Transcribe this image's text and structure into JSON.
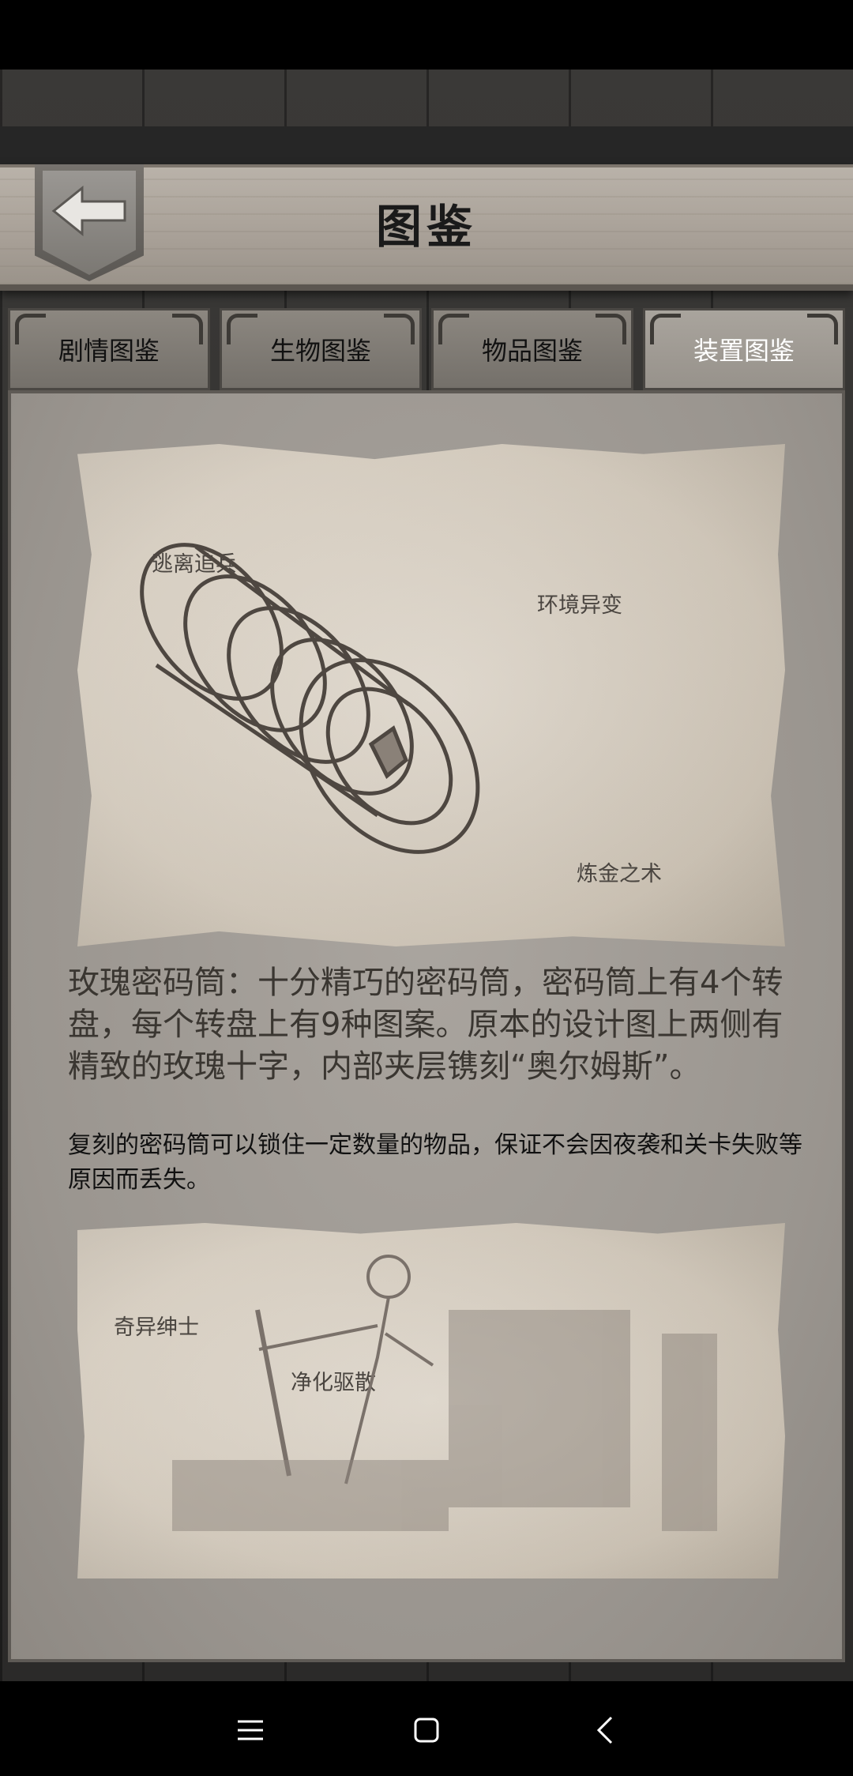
{
  "header": {
    "title": "图鉴"
  },
  "tabs": [
    {
      "label": "剧情图鉴"
    },
    {
      "label": "生物图鉴"
    },
    {
      "label": "物品图鉴"
    },
    {
      "label": "装置图鉴"
    }
  ],
  "entry1": {
    "labels": [
      "逃离追兵",
      "环境异变",
      "炼金之术"
    ],
    "description": "玫瑰密码筒：十分精巧的密码筒，密码筒上有4个转盘，每个转盘上有9种图案。原本的设计图上两侧有精致的玫瑰十字，内部夹层镌刻“奥尔姆斯”。",
    "effect": "复刻的密码筒可以锁住一定数量的物品，保证不会因夜袭和关卡失败等原因而丢失。"
  },
  "entry2": {
    "labels": [
      "奇异绅士",
      "净化驱散"
    ]
  },
  "colors": {
    "active_tab_text": "#ffffff",
    "tab_text": "#111111",
    "parchment": "#d9d0c2"
  },
  "icons": {
    "back": "arrow-left-icon",
    "menu": "menu-icon",
    "home": "home-icon",
    "back_nav": "chevron-left-icon"
  }
}
